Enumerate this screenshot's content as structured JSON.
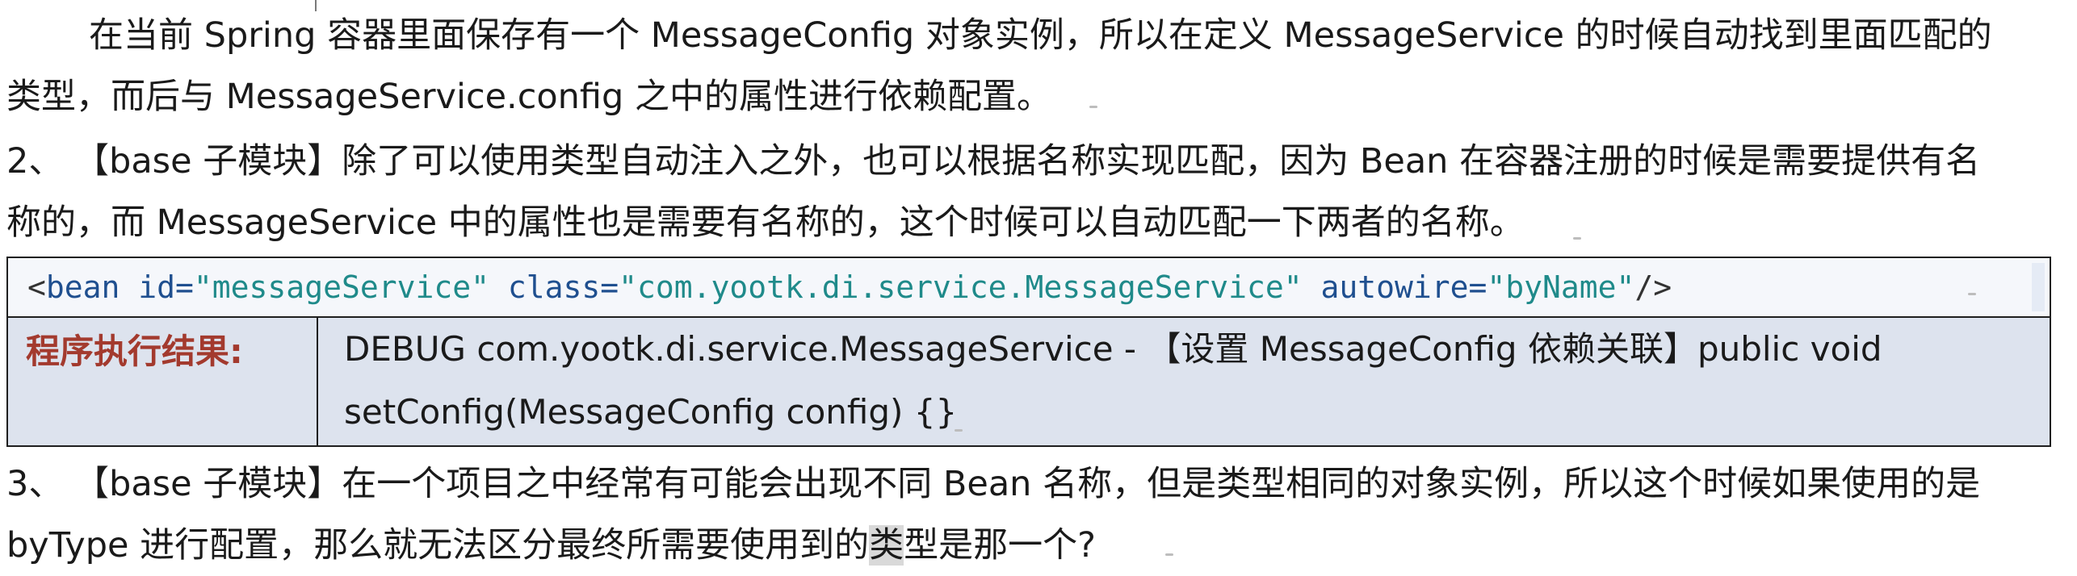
{
  "paragraphs": {
    "p1_line1": "在当前 Spring 容器里面保存有一个 MessageConfig 对象实例，所以在定义 MessageService 的时候自动找到里面匹配的",
    "p1_line2": "类型，而后与 MessageService.config 之中的属性进行依赖配置。",
    "p2_line1": "2、 【base 子模块】除了可以使用类型自动注入之外，也可以根据名称实现匹配，因为 Bean 在容器注册的时候是需要提供有名",
    "p2_line2": "称的，而 MessageService 中的属性也是需要有名称的，这个时候可以自动匹配一下两者的名称。",
    "p3_line1": "3、 【base 子模块】在一个项目之中经常有可能会出现不同 Bean 名称，但是类型相同的对象实例，所以这个时候如果使用的是",
    "p3_line2_before": "byType 进行配置，那么就无法区分最终所需要使用到的",
    "p3_line2_highlight": "类",
    "p3_line2_after": "型是那一个?"
  },
  "code": {
    "open": "<",
    "tag": "bean",
    "attr1_name": " id=",
    "attr1_value": "\"messageService\"",
    "attr2_name": " class=",
    "attr2_value": "\"com.yootk.di.service.MessageService\"",
    "attr3_name": " autowire=",
    "attr3_value": "\"byName\"",
    "close": "/>"
  },
  "result": {
    "label": "程序执行结果:",
    "line1": "DEBUG  com.yootk.di.service.MessageService  -  【设置  MessageConfig  依赖关联】public  void",
    "line2": "setConfig(MessageConfig config) {}"
  }
}
